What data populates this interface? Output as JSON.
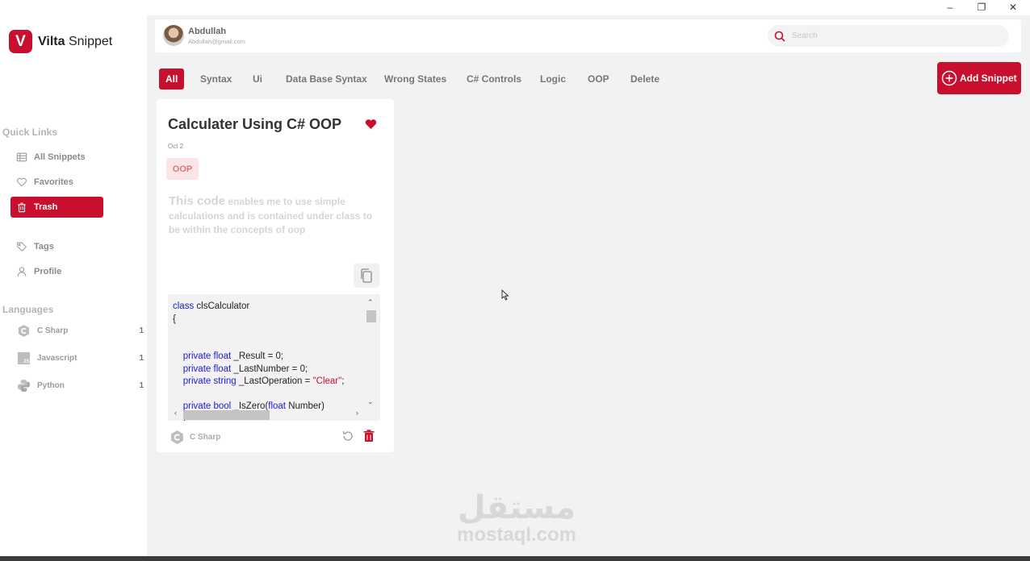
{
  "app": {
    "brand_letter": "V",
    "brand_name_bold": "Vilta",
    "brand_name_rest": " Snippet",
    "accent": "#c8102e"
  },
  "window_controls": {
    "minimize": "–",
    "maximize": "❐",
    "close": "✕"
  },
  "sidebar": {
    "quick_links_title": "Quick Links",
    "quick_links": [
      {
        "label": "All Snippets",
        "icon": "table-icon",
        "active": false
      },
      {
        "label": "Favorites",
        "icon": "heart-icon",
        "active": false
      },
      {
        "label": "Trash",
        "icon": "trash-icon",
        "active": true
      }
    ],
    "other_links": [
      {
        "label": "Tags",
        "icon": "tag-icon"
      },
      {
        "label": "Profile",
        "icon": "user-icon"
      }
    ],
    "languages_title": "Languages",
    "languages": [
      {
        "label": "C Sharp",
        "count": "1",
        "icon": "csharp-icon"
      },
      {
        "label": "Javascript",
        "count": "1",
        "icon": "javascript-icon"
      },
      {
        "label": "Python",
        "count": "1",
        "icon": "python-icon"
      }
    ]
  },
  "header": {
    "user_name": "Abdullah",
    "user_email": "Abdullah@gmail.com",
    "search_placeholder": "Search"
  },
  "tabs": [
    {
      "label": "All",
      "active": true
    },
    {
      "label": "Syntax",
      "active": false
    },
    {
      "label": "Ui",
      "active": false
    },
    {
      "label": "Data Base Syntax",
      "active": false
    },
    {
      "label": "Wrong States",
      "active": false
    },
    {
      "label": "C# Controls",
      "active": false
    },
    {
      "label": "Logic",
      "active": false
    },
    {
      "label": "OOP",
      "active": false
    },
    {
      "label": "Delete",
      "active": false
    }
  ],
  "add_snippet_label": "Add Snippet",
  "snippet": {
    "title": "Calculater Using C# OOP",
    "date": "Oct 2",
    "tag": "OOP",
    "desc_big": "This code",
    "desc_rest": " enables me to use simple calculations and is contained under class to be within the concepts of oop",
    "language": "C Sharp",
    "favorite": true
  },
  "watermark": {
    "arabic": "مستقل",
    "latin": "mostaql.com"
  }
}
